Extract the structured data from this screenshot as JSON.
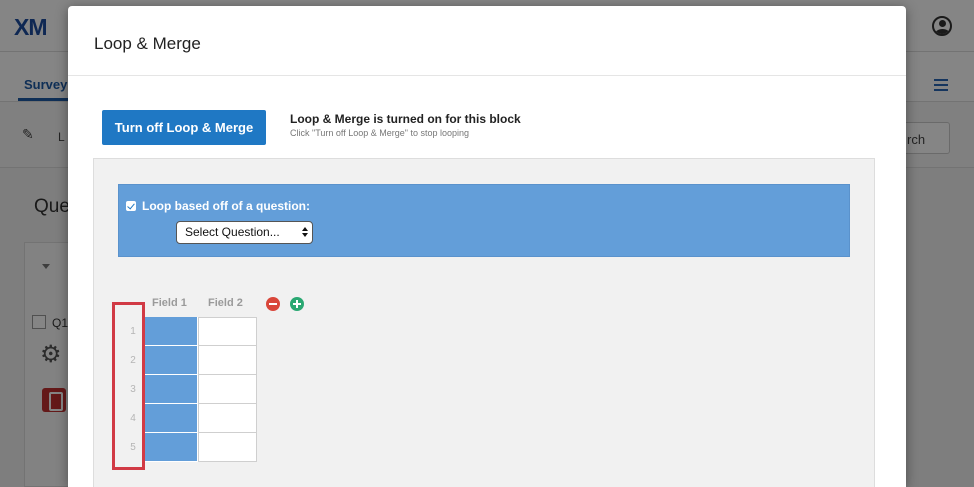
{
  "app": {
    "logo": "XM",
    "tabs": [
      {
        "label": "Survey"
      }
    ],
    "toolbar": {
      "partial_label": "L",
      "search_partial": "rch"
    },
    "content": {
      "title_partial": "Que",
      "question_partial": "Q1"
    }
  },
  "modal": {
    "title": "Loop & Merge",
    "turn_off_button": "Turn off Loop & Merge",
    "status_title": "Loop & Merge is turned on for this block",
    "status_subtitle": "Click \"Turn off Loop & Merge\" to stop looping",
    "loop_option_label": "Loop based off of a question:",
    "select_value": "Select Question...",
    "fields": [
      "Field 1",
      "Field 2"
    ],
    "rows": [
      "1",
      "2",
      "3",
      "4",
      "5"
    ]
  },
  "colors": {
    "accent": "#1f78c4",
    "loop_bar": "#639ed9",
    "highlight": "#d13a45",
    "minus": "#d9463a",
    "plus": "#2aa872"
  }
}
